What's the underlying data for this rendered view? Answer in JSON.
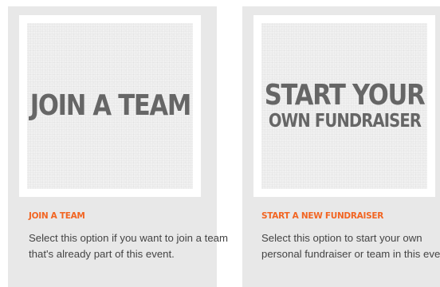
{
  "cards": [
    {
      "tile_lines": [
        "JOIN A TEAM"
      ],
      "title": "JOIN A TEAM",
      "description": "Select this option if you want to join a team that's already part of this event."
    },
    {
      "tile_lines": [
        "START YOUR",
        "OWN FUNDRAISER"
      ],
      "title": "START A NEW FUNDRAISER",
      "description": "Select this option to start your own personal fundraiser or team in this event."
    }
  ],
  "colors": {
    "accent": "#f26522",
    "card_background": "#e8e8e8",
    "tile_text": "#666666",
    "body_text": "#444444"
  }
}
